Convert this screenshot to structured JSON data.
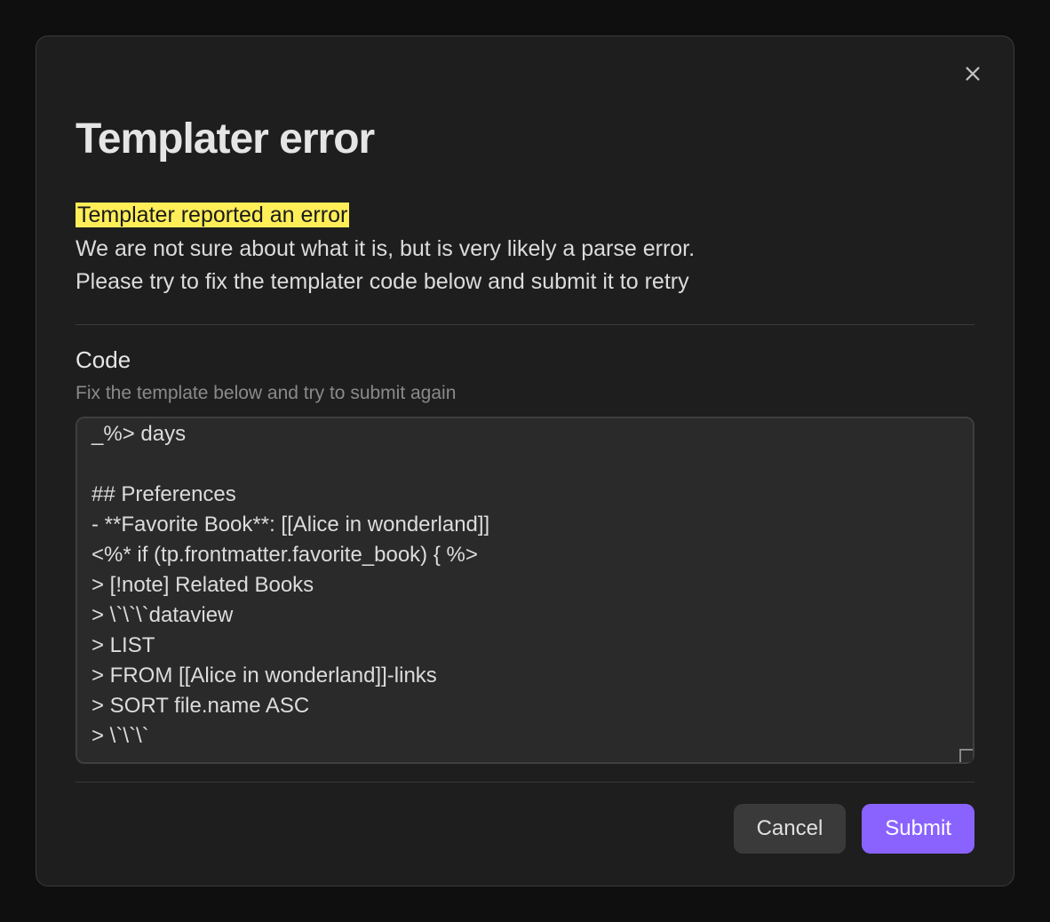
{
  "modal": {
    "title": "Templater error",
    "highlighted_line": "Templater reported an error",
    "description_line2": "We are not sure about what it is, but is very likely a parse error.",
    "description_line3": "Please try to fix the templater code below and submit it to retry",
    "section_label": "Code",
    "section_sublabel": "Fix the template below and try to submit again",
    "code_value": "_%> days\n\n## Preferences\n- **Favorite Book**: [[Alice in wonderland]]\n<%* if (tp.frontmatter.favorite_book) { %>\n> [!note] Related Books\n> \\`\\`\\`dataview\n> LIST\n> FROM [[Alice in wonderland]]-links\n> SORT file.name ASC\n> \\`\\`\\`",
    "footer": {
      "cancel_label": "Cancel",
      "submit_label": "Submit"
    },
    "colors": {
      "accent": "#8a63ff",
      "highlight": "#ffee58",
      "bg": "#1e1e1e"
    }
  }
}
